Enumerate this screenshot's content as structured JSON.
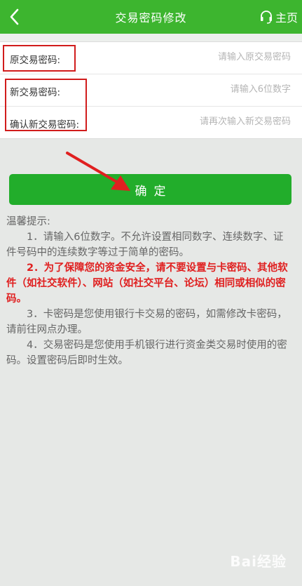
{
  "header": {
    "title": "交易密码修改",
    "home_label": "主页"
  },
  "form": {
    "original": {
      "label": "原交易密码:",
      "placeholder": "请输入原交易密码"
    },
    "new": {
      "label": "新交易密码:",
      "placeholder": "请输入6位数字"
    },
    "confirm": {
      "label": "确认新交易密码:",
      "placeholder": "请再次输入新交易密码"
    }
  },
  "confirm_button": {
    "label": "确定"
  },
  "tips": {
    "heading": "温馨提示:",
    "items": [
      "1．请输入6位数字。不允许设置相同数字、连续数字、证件号码中的连续数字等过于简单的密码。",
      "2．为了保障您的资金安全，请不要设置与卡密码、其他软件（如社交软件）、网站（如社交平台、论坛）相同或相似的密码。",
      "3．卡密码是您使用银行卡交易的密码，如需修改卡密码，请前往网点办理。",
      "4．交易密码是您使用手机银行进行资金类交易时使用的密码。设置密码后即时生效。"
    ]
  },
  "watermark": {
    "text": "Bai经验"
  },
  "colors": {
    "header_green": "#3db52f",
    "button_green": "#22ad2b",
    "highlight_red": "#e02020",
    "annotation_red": "#d11c1c"
  }
}
